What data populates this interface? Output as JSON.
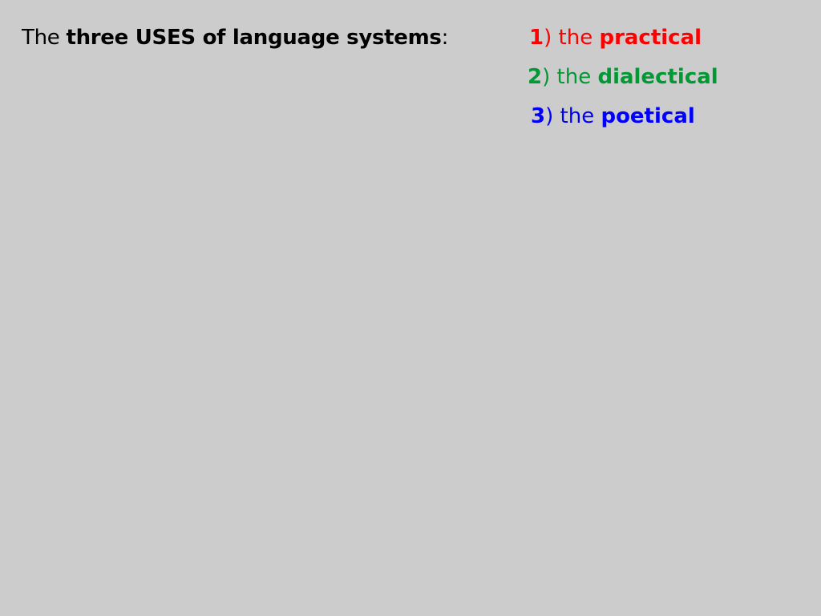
{
  "title": {
    "prefix": "The",
    "bold": "three USES of language systems",
    "suffix": ":"
  },
  "items": [
    {
      "number": "1",
      "paren": ")",
      "article": "the",
      "term": "practical",
      "color": "#ff0000"
    },
    {
      "number": "2",
      "paren": ")",
      "article": "the",
      "term": "dialectical",
      "color": "#009933"
    },
    {
      "number": "3",
      "paren": ")",
      "article": "the",
      "term": "poetical",
      "color": "#0000ff"
    }
  ]
}
